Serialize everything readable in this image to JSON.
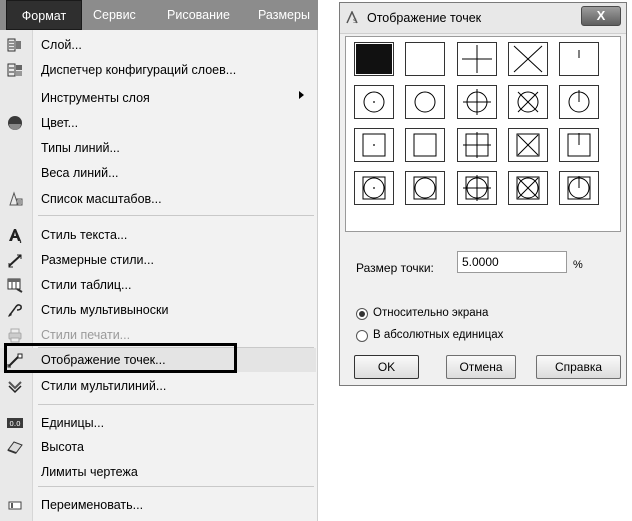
{
  "menubar": {
    "items": [
      {
        "label": "Формат"
      },
      {
        "label": "Сервис"
      },
      {
        "label": "Рисование"
      },
      {
        "label": "Размеры"
      }
    ],
    "active_index": 0
  },
  "menu": {
    "items": [
      {
        "label": "Слой...",
        "icon": "layer-icon"
      },
      {
        "label": "Диспетчер конфигураций слоев...",
        "icon": "layer-states-icon"
      },
      {
        "label": "Инструменты слоя",
        "icon": "",
        "submenu": true
      },
      {
        "label": "Цвет...",
        "icon": "color-icon"
      },
      {
        "label": "Типы линий...",
        "icon": ""
      },
      {
        "label": "Веса линий...",
        "icon": ""
      },
      {
        "label": "Список масштабов...",
        "icon": "scale-list-icon"
      },
      {
        "label": "Стиль текста...",
        "icon": "text-style-icon"
      },
      {
        "label": "Размерные стили...",
        "icon": "dimension-style-icon"
      },
      {
        "label": "Стили таблиц...",
        "icon": "table-style-icon"
      },
      {
        "label": "Стиль мультивыноски",
        "icon": "multileader-style-icon"
      },
      {
        "label": "Стили печати...",
        "icon": "plot-style-icon",
        "disabled": true
      },
      {
        "label": "Отображение точек...",
        "icon": "point-style-icon",
        "highlighted": true
      },
      {
        "label": "Стили мультилиний...",
        "icon": "multiline-style-icon"
      },
      {
        "label": "Единицы...",
        "icon": "units-icon"
      },
      {
        "label": "Высота",
        "icon": "thickness-icon"
      },
      {
        "label": "Лимиты чертежа",
        "icon": ""
      },
      {
        "label": "Переименовать...",
        "icon": "rename-icon"
      }
    ]
  },
  "dialog": {
    "title": "Отображение точек",
    "close_label": "X",
    "point_styles_selected_index": 0,
    "point_size_label": "Размер точки:",
    "point_size_value": "5.0000",
    "point_size_unit": "%",
    "radio_relative_label": "Относительно экрана",
    "radio_absolute_label": "В абсолютных единицах",
    "radio_selected": "relative",
    "ok_label": "OK",
    "cancel_label": "Отмена",
    "help_label": "Справка"
  },
  "colors": {
    "menubar_bg": "#8c8c8c",
    "menu_bg": "#f2f2f2",
    "dialog_bg": "#f0f0f0"
  }
}
